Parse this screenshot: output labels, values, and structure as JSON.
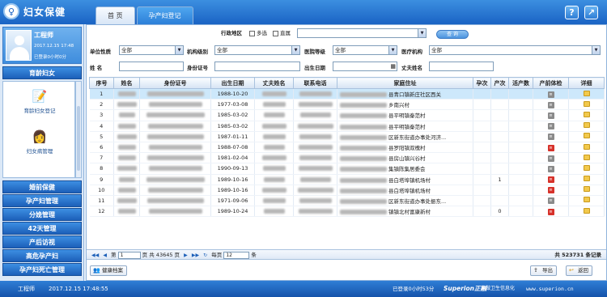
{
  "app": {
    "title": "妇女保健"
  },
  "tabs": [
    {
      "label": "首  页",
      "active": false
    },
    {
      "label": "孕产妇登记",
      "active": true
    }
  ],
  "header_buttons": {
    "help": "?",
    "exit": "↗"
  },
  "user": {
    "name": "工程师",
    "time": "2017.12.15 17:48",
    "logged": "已登录0小时0分"
  },
  "sidebar": {
    "top_section": "育龄妇女",
    "sub_items": [
      {
        "label": "育龄妇女登记",
        "icon": "pencil-notebook-icon"
      },
      {
        "label": "妇女病管理",
        "icon": "person-badge-icon"
      }
    ],
    "sections": [
      "婚前保健",
      "孕产妇管理",
      "分娩管理",
      "42天管理",
      "产后访视",
      "高危孕产妇",
      "孕产妇死亡管理"
    ]
  },
  "filters": {
    "district_label": "行政地区",
    "multi_label": "多选",
    "direct_label": "直属",
    "query_button": "查  询",
    "unit_nature_label": "单位性质",
    "unit_nature_value": "全部",
    "org_level_label": "机构级别",
    "org_level_value": "全部",
    "hospital_grade_label": "医院等级",
    "hospital_grade_value": "全部",
    "medical_org_label": "医疗机构",
    "medical_org_value": "全部",
    "name_label": "姓    名",
    "id_label": "身份证号",
    "birth_label": "出生日期",
    "husband_label": "丈夫姓名"
  },
  "table": {
    "headers": [
      "序号",
      "姓名",
      "身份证号",
      "出生日期",
      "丈夫姓名",
      "联系电话",
      "家庭住址",
      "孕次",
      "产次",
      "活产数",
      "产前体检",
      "详细"
    ],
    "rows": [
      {
        "no": "1",
        "birth": "1988-10-20",
        "address": "县青口镇新庄社区西关",
        "gravida": "",
        "para": "",
        "check": "gray"
      },
      {
        "no": "2",
        "birth": "1977-03-08",
        "address": "乡南兴村",
        "gravida": "",
        "para": "",
        "check": "gray"
      },
      {
        "no": "3",
        "birth": "1985-03-02",
        "address": "县平明镇秦范村",
        "gravida": "",
        "para": "",
        "check": "gray"
      },
      {
        "no": "4",
        "birth": "1985-03-02",
        "address": "县平明镇秦范村",
        "gravida": "",
        "para": "",
        "check": "gray"
      },
      {
        "no": "5",
        "birth": "1987-01-11",
        "address": "区新东街道办事处河济...",
        "gravida": "",
        "para": "",
        "check": "gray"
      },
      {
        "no": "6",
        "birth": "1988-07-08",
        "address": "县罗阳镇双槐村",
        "gravida": "",
        "para": "",
        "check": "red"
      },
      {
        "no": "7",
        "birth": "1981-02-04",
        "address": "县房山镇兴谷村",
        "gravida": "",
        "para": "",
        "check": "gray"
      },
      {
        "no": "8",
        "birth": "1990-09-13",
        "address": "集镇陈集居委会",
        "gravida": "",
        "para": "",
        "check": "gray"
      },
      {
        "no": "9",
        "birth": "1989-10-16",
        "address": "县白塔埠镇机场村",
        "gravida": "",
        "para": "1",
        "check": "red"
      },
      {
        "no": "10",
        "birth": "1989-10-16",
        "address": "县白塔埠镇机场村",
        "gravida": "",
        "para": "",
        "check": "red"
      },
      {
        "no": "11",
        "birth": "1971-09-06",
        "address": "区新东街道办事处振东...",
        "gravida": "",
        "para": "",
        "check": "gray"
      },
      {
        "no": "12",
        "birth": "1989-10-24",
        "address": "镇镇北村富康新村",
        "gravida": "",
        "para": "0",
        "check": "red"
      }
    ]
  },
  "pager": {
    "page_label": "第",
    "page_value": "1",
    "total_pages_text": "页 共 43645 页",
    "per_page_label": "每页",
    "per_page_value": "12",
    "per_page_unit": "条",
    "total_records": "共 523731 条记录"
  },
  "buttons": {
    "health_file": "健康档案",
    "export": "导出",
    "back": "返回"
  },
  "status": {
    "user": "工程师",
    "time": "2017.12.15 17:48:55",
    "logged": "已登录0小时53分",
    "brand": "Superion正融",
    "slogan": "只做卫生信息化",
    "url": "www.superion.cn"
  },
  "colors": {
    "header": "#1a63c4",
    "selected_row": "#cde8fb",
    "alert": "#d6312a"
  }
}
